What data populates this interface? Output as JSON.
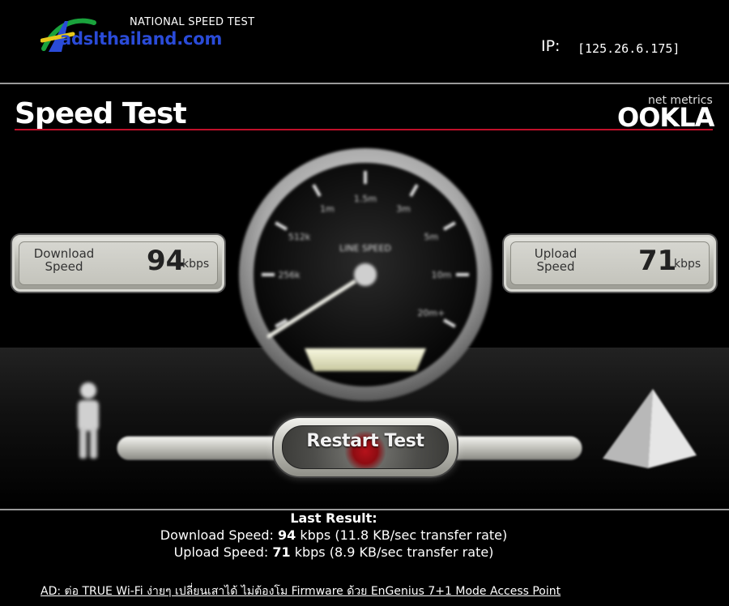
{
  "header": {
    "brand_tagline": "NATIONAL SPEED TEST",
    "brand_name": "adslthailand.com",
    "ip_label": "IP:",
    "ip_value": "[125.26.6.175]"
  },
  "panel": {
    "title": "Speed Test",
    "vendor_sub": "net metrics",
    "vendor_name": "OOKLA"
  },
  "gauge": {
    "center_label": "LINE SPEED",
    "tick_labels": [
      "256k",
      "512k",
      "1m",
      "1.5m",
      "3m",
      "5m",
      "10m",
      "20m+"
    ]
  },
  "download": {
    "label_line1": "Download",
    "label_line2": "Speed",
    "value": "94",
    "unit": "kbps"
  },
  "upload": {
    "label_line1": "Upload",
    "label_line2": "Speed",
    "value": "71",
    "unit": "kbps"
  },
  "restart_button_label": "Restart Test",
  "last_result": {
    "title": "Last Result:",
    "download_prefix": "Download Speed: ",
    "download_value": "94",
    "download_suffix": " kbps (11.8 KB/sec transfer rate)",
    "upload_prefix": "Upload Speed: ",
    "upload_value": "71",
    "upload_suffix": " kbps (8.9 KB/sec transfer rate)"
  },
  "ad_text": "AD: ต่อ TRUE Wi-Fi ง่ายๆ เปลี่ยนเสาได้ ไม่ต้องโม Firmware ด้วย EnGenius 7+1 Mode Access Point",
  "colors": {
    "background": "#000000",
    "accent_rule": "#c0102a",
    "brand_blue": "#2a4bd8",
    "logo_green": "#1aa23c",
    "logo_yellow": "#e8c81a"
  }
}
